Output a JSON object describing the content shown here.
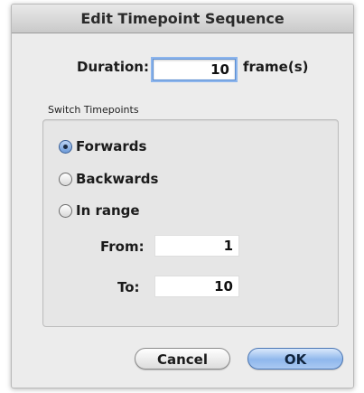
{
  "window": {
    "title": "Edit Timepoint Sequence"
  },
  "duration": {
    "label": "Duration:",
    "value": "10",
    "unit": "frame(s)"
  },
  "switch_group": {
    "title": "Switch Timepoints",
    "options": [
      {
        "label": "Forwards",
        "checked": true
      },
      {
        "label": "Backwards",
        "checked": false
      },
      {
        "label": "In range",
        "checked": false
      }
    ],
    "from": {
      "label": "From:",
      "value": "1"
    },
    "to": {
      "label": "To:",
      "value": "10"
    }
  },
  "buttons": {
    "cancel": "Cancel",
    "ok": "OK"
  },
  "colors": {
    "accent": "#6d9ad8",
    "dialog_bg": "#ececec"
  }
}
